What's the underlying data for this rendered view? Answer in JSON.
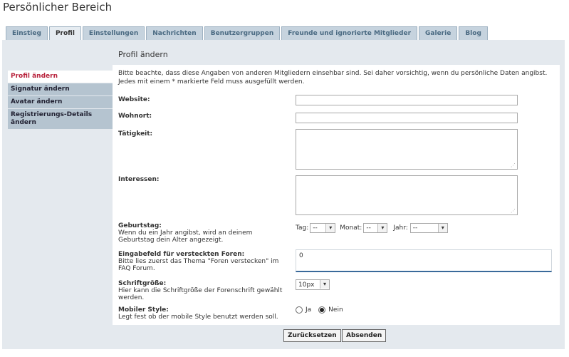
{
  "page_title": "Persönlicher Bereich",
  "tabs": [
    {
      "label": "Einstieg"
    },
    {
      "label": "Profil"
    },
    {
      "label": "Einstellungen"
    },
    {
      "label": "Nachrichten"
    },
    {
      "label": "Benutzergruppen"
    },
    {
      "label": "Freunde und ignorierte Mitglieder"
    },
    {
      "label": "Galerie"
    },
    {
      "label": "Blog"
    }
  ],
  "sidebar": {
    "items": [
      {
        "label": "Profil ändern"
      },
      {
        "label": "Signatur ändern"
      },
      {
        "label": "Avatar ändern"
      },
      {
        "label": "Registrierungs-Details ändern"
      }
    ]
  },
  "panel": {
    "heading": "Profil ändern",
    "intro": "Bitte beachte, dass diese Angaben von anderen Mitgliedern einsehbar sind. Sei daher vorsichtig, wenn du persönliche Daten angibst. Jedes mit einem * markierte Feld muss ausgefüllt werden."
  },
  "fields": {
    "website": {
      "label": "Website:",
      "value": ""
    },
    "wohnort": {
      "label": "Wohnort:",
      "value": ""
    },
    "taetigkeit": {
      "label": "Tätigkeit:",
      "value": ""
    },
    "interessen": {
      "label": "Interessen:",
      "value": ""
    },
    "geburtstag": {
      "label": "Geburtstag:",
      "hint": "Wenn du ein Jahr angibst, wird an deinem Geburtstag dein Alter angezeigt.",
      "tag_label": "Tag:",
      "tag_value": "--",
      "monat_label": "Monat:",
      "monat_value": "--",
      "jahr_label": "Jahr:",
      "jahr_value": "--"
    },
    "hidden_forums": {
      "label": "Eingabefeld für versteckten Foren:",
      "hint": "Bitte lies zuerst das Thema \"Foren verstecken\" im FAQ Forum.",
      "value": "0"
    },
    "schriftgroesse": {
      "label": "Schriftgröße:",
      "hint": "Hier kann die Schriftgröße der Forenschrift gewählt werden.",
      "value": "10px"
    },
    "mobiler_style": {
      "label": "Mobiler Style:",
      "hint": "Legt fest ob der mobile Style benutzt werden soll.",
      "option_ja": "Ja",
      "option_nein": "Nein",
      "selected": "Nein"
    }
  },
  "buttons": {
    "reset": "Zurücksetzen",
    "submit": "Absenden"
  },
  "icons": {
    "select_arrow": "chevron-down-icon",
    "resize_grip": "resize-grip-icon"
  },
  "colors": {
    "tab_bg": "#c6d3de",
    "content_band": "#e4e9ee",
    "sidebar_item": "#b5c4d0",
    "active_link": "#b8223c",
    "focus_border": "#3a6a9a"
  }
}
